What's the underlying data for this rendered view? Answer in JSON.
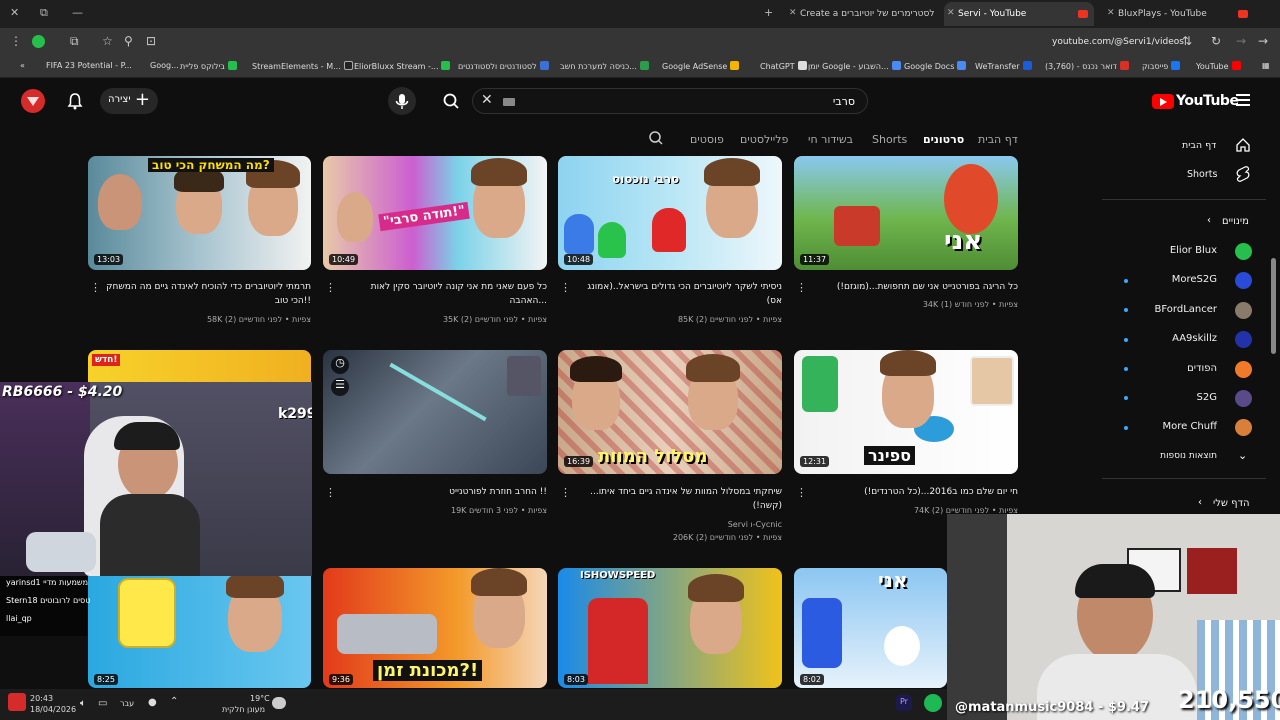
{
  "browser": {
    "tabs": [
      {
        "title": "Create a טורניר לסטרימרים של יוטיוברים"
      },
      {
        "title": "Servi - YouTube"
      },
      {
        "title": "BluxPlays - YouTube"
      }
    ],
    "url": "youtube.com/@Servi1/videos",
    "bookmarks": [
      "FIFA 23 Potential - P...",
      "Goog...",
      "בילוקס פליית",
      "StreamElements - M...",
      "EliorBluxx Stream -...",
      "לסטודנטים ולסטודנטים",
      "כניסה למערכת חשב...",
      "Google AdSense",
      "ChatGPT",
      "יומן Google - השבוע...",
      "Google Docs",
      "WeTransfer",
      "(3,760) - דואר נכנס",
      "פייסבוק",
      "YouTube"
    ]
  },
  "header": {
    "logo_text": "YouTube",
    "search_value": "סרבי",
    "create_label": "יצירה",
    "icons": [
      "menu-icon",
      "search-icon",
      "mic-icon",
      "bell-icon"
    ]
  },
  "channel_tabs": [
    {
      "label": "דף הבית",
      "active": false
    },
    {
      "label": "סרטונים",
      "active": true
    },
    {
      "label": "Shorts",
      "active": false
    },
    {
      "label": "בשידור חי",
      "active": false
    },
    {
      "label": "פליילסטים",
      "active": false
    },
    {
      "label": "פוסטים",
      "active": false
    }
  ],
  "sidebar": {
    "main": [
      {
        "label": "דף הבית",
        "icon": "home-icon"
      },
      {
        "label": "Shorts",
        "icon": "shorts-icon"
      }
    ],
    "subs_header": "מינויים",
    "subs": [
      {
        "name": "Elior Blux",
        "color": "#25c04b"
      },
      {
        "name": "MoreS2G",
        "color": "#2a4bd8"
      },
      {
        "name": "BFordLancer",
        "color": "#8a7a6a"
      },
      {
        "name": "AA9skillz",
        "color": "#2233aa"
      },
      {
        "name": "הפודים",
        "color": "#f07a2a"
      },
      {
        "name": "S2G",
        "color": "#5a4a8a"
      },
      {
        "name": "More Chuff",
        "color": "#d8803a"
      }
    ],
    "show_more": "תוצאות נוספות",
    "you_header": "הדף שלי"
  },
  "videos": [
    {
      "title": "תרמתי ליוטיוברים כדי להוכיח לאינדה גיים מה המשחק הכי טוב!!",
      "views": "58K צפיות",
      "age": "לפני חודשיים (2)",
      "duration": "13:03",
      "overlay": "מה המשחק הכי טוב?"
    },
    {
      "title": "כל פעם שאני מת אני קונה ליוטיובר סקין לאות האהבה...",
      "views": "35K צפיות",
      "age": "לפני חודשיים (2)",
      "duration": "10:49",
      "overlay": "\"תודה סרבי!\""
    },
    {
      "title": "ניסיתי לשקר ליוטיוברים הכי גדולים בישראל..(אמונג אס)",
      "views": "85K צפיות",
      "age": "לפני חודשיים (2)",
      "duration": "10:48",
      "overlay": "סרבי נוכסוס"
    },
    {
      "title": "כל הריגה בפורטנייט אני שם תחפושת...(מוגזם!)",
      "views": "34K צפיות",
      "age": "לפני חודש (1)",
      "duration": "11:37",
      "overlay": "אני"
    },
    {
      "title": "",
      "views": "",
      "age": "",
      "duration": "",
      "overlay": "חדש!"
    },
    {
      "title": "החרב חוזרת לפורטנייט !!",
      "views": "19K צפיות",
      "age": "לפני 3 חודשים",
      "duration": "",
      "overlay": ""
    },
    {
      "title": "שיחקתי במסלול המוות של אינדה גיים ביחד איתו... (קשה!)",
      "views": "206K צפיות",
      "age": "לפני חודשיים (2)",
      "authors": "Servi ו-Cycnic",
      "duration": "16:39",
      "overlay": "מסלול המוות"
    },
    {
      "title": "חי יום שלם כמו ב2016...(כל הטרנדים!)",
      "views": "74K צפיות",
      "age": "לפני חודשיים (2)",
      "duration": "12:31",
      "overlay": "ספינר"
    },
    {
      "title": "",
      "views": "",
      "age": "",
      "duration": "8:25",
      "overlay": ""
    },
    {
      "title": "",
      "views": "",
      "age": "",
      "duration": "9:36",
      "overlay": "מכונת זמן?!"
    },
    {
      "title": "",
      "views": "",
      "age": "",
      "duration": "8:03",
      "overlay": "ISHOWSPEED"
    },
    {
      "title": "",
      "views": "",
      "age": "",
      "duration": "8:02",
      "overlay": "אני"
    }
  ],
  "stream_overlay": {
    "donation_top": "RB6666 - $4.20",
    "donation_bottom": "@matanmusic9084 - $9.47",
    "viewers": "210,550",
    "badge": "k299",
    "chat": [
      "yarinsd1 משמעות מדיי",
      "Stern18 טסים לרובוטים",
      "llai_qp"
    ]
  },
  "taskbar": {
    "time": "20:43",
    "date": "18/04/2026",
    "lang": "עבר",
    "weather_temp": "19°C",
    "weather_desc": "מעונן חלקית"
  }
}
